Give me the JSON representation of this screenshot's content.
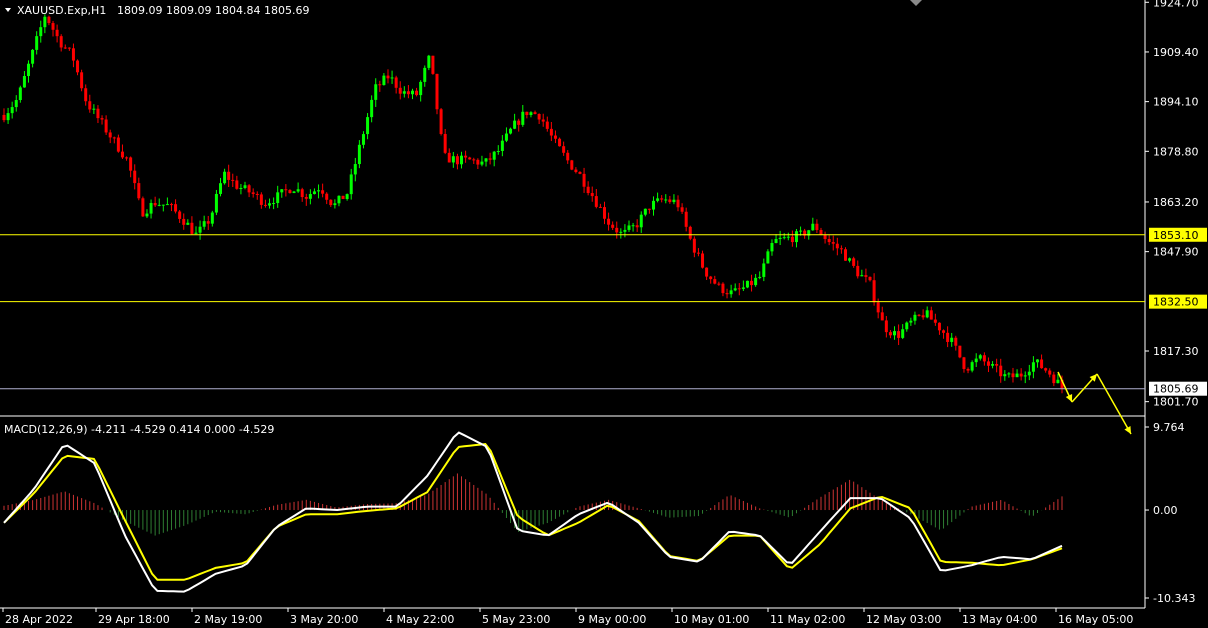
{
  "chart_info": {
    "symbol_label": "XAUUSD.Exp,H1",
    "ohlc_label": "1809.09 1809.09 1804.84 1805.69"
  },
  "macd_info": {
    "label": "MACD(12,26,9) -4.211 -4.529 0.414 0.000 -4.529"
  },
  "colors": {
    "background": "#000000",
    "bull_candle": "#00ff00",
    "bear_candle": "#ff0000",
    "level_line": "#ffff00",
    "current_price_line": "#b0b0d0",
    "macd_line": "#ffffff",
    "signal_line": "#ffff00",
    "hist_positive": "#cc3333",
    "hist_negative": "#2e7d32",
    "axis_text": "#ffffff"
  },
  "chart_data": [
    {
      "type": "candlestick",
      "ylim": [
        1797.9,
        1925.4
      ],
      "yticks": [
        "1924.70",
        "1909.40",
        "1894.10",
        "1878.80",
        "1863.20",
        "1847.90",
        "1817.30",
        "1801.70"
      ],
      "xticks": [
        "28 Apr 2022",
        "29 Apr 18:00",
        "2 May 19:00",
        "3 May 20:00",
        "4 May 22:00",
        "5 May 23:00",
        "9 May 00:00",
        "10 May 01:00",
        "11 May 02:00",
        "12 May 03:00",
        "13 May 04:00",
        "16 May 05:00"
      ],
      "price_path": [
        1890,
        1895,
        1908,
        1921,
        1913,
        1908,
        1894,
        1888,
        1882,
        1876,
        1860,
        1863,
        1862,
        1858,
        1853,
        1858,
        1872,
        1868,
        1866,
        1863,
        1865,
        1868,
        1865,
        1868,
        1862,
        1866,
        1882,
        1898,
        1902,
        1897,
        1896,
        1908,
        1877,
        1876,
        1876,
        1875,
        1879,
        1886,
        1891,
        1890,
        1882,
        1876,
        1871,
        1864,
        1857,
        1853,
        1856,
        1862,
        1864,
        1863,
        1851,
        1842,
        1837,
        1835,
        1837,
        1840,
        1851,
        1852,
        1853,
        1856,
        1851,
        1848,
        1842,
        1838,
        1825,
        1822,
        1826,
        1829,
        1825,
        1820,
        1812,
        1815,
        1812,
        1809,
        1810,
        1814,
        1811,
        1806
      ],
      "horizontal_levels": [
        "1853.10",
        "1832.50"
      ],
      "current_price": "1805.69",
      "projection_arrows": "yellow zigzag: down, up, then down"
    },
    {
      "type": "macd",
      "parameters": "12,26,9",
      "values": {
        "macd": -4.211,
        "signal": -4.529
      },
      "ylim": [
        -10.343,
        9.764
      ],
      "yticks": [
        "9.764",
        "0.00",
        "-10.343"
      ],
      "macd_path": [
        -1.5,
        2.5,
        7.8,
        5.5,
        -3.0,
        -9.5,
        -9.6,
        -7.5,
        -6.5,
        -2.0,
        0.2,
        0.0,
        0.4,
        0.4,
        4.0,
        9.2,
        7.4,
        -2.4,
        -3.0,
        -0.5,
        0.9,
        -1.5,
        -5.5,
        -6.1,
        -2.5,
        -3.0,
        -6.5,
        -2.5,
        1.4,
        1.4,
        -1.0,
        -7.2,
        -6.5,
        -5.5,
        -5.8,
        -4.2
      ],
      "signal_path": [
        -1.5,
        2.0,
        6.4,
        6.0,
        -1.2,
        -8.2,
        -8.2,
        -6.8,
        -6.2,
        -2.0,
        -0.5,
        -0.5,
        -0.1,
        0.2,
        2.1,
        7.4,
        7.8,
        -0.8,
        -3.0,
        -1.5,
        0.6,
        -1.3,
        -5.4,
        -6.0,
        -3.0,
        -3.0,
        -7.0,
        -4.0,
        0.2,
        1.6,
        0.2,
        -6.1,
        -6.2,
        -6.5,
        -5.8,
        -4.5
      ],
      "histogram_path": [
        0.5,
        1.2,
        2.2,
        0.8,
        -1.3,
        -3.0,
        -1.8,
        -0.2,
        -0.5,
        0.6,
        1.2,
        0.3,
        0.7,
        0.8,
        1.8,
        4.3,
        1.8,
        -2.6,
        -1.5,
        0.4,
        1.2,
        0.2,
        -0.9,
        -0.7,
        1.8,
        0.2,
        -0.9,
        1.5,
        3.6,
        1.2,
        -0.5,
        -2.4,
        0.4,
        1.2,
        -0.8,
        1.6
      ]
    }
  ]
}
